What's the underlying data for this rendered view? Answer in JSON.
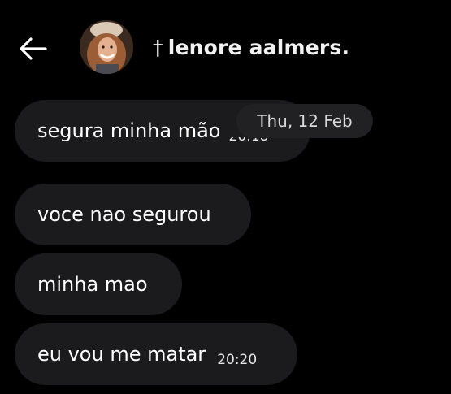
{
  "header": {
    "back_icon": "arrow-left-icon",
    "contact_name": "lenore aalmers.",
    "name_prefix_glyph": "†",
    "avatar": "profile-photo"
  },
  "date_separator": "Thu, 12 Feb",
  "messages": [
    {
      "text": "segura minha mão",
      "time": "20:18"
    },
    {
      "text": "voce nao segurou",
      "time": ""
    },
    {
      "text": "minha mao",
      "time": ""
    },
    {
      "text": "eu vou me matar",
      "time": "20:20"
    }
  ],
  "colors": {
    "background": "#000000",
    "bubble": "#1b1b1d",
    "date_pill": "#212124",
    "text": "#ffffff"
  }
}
